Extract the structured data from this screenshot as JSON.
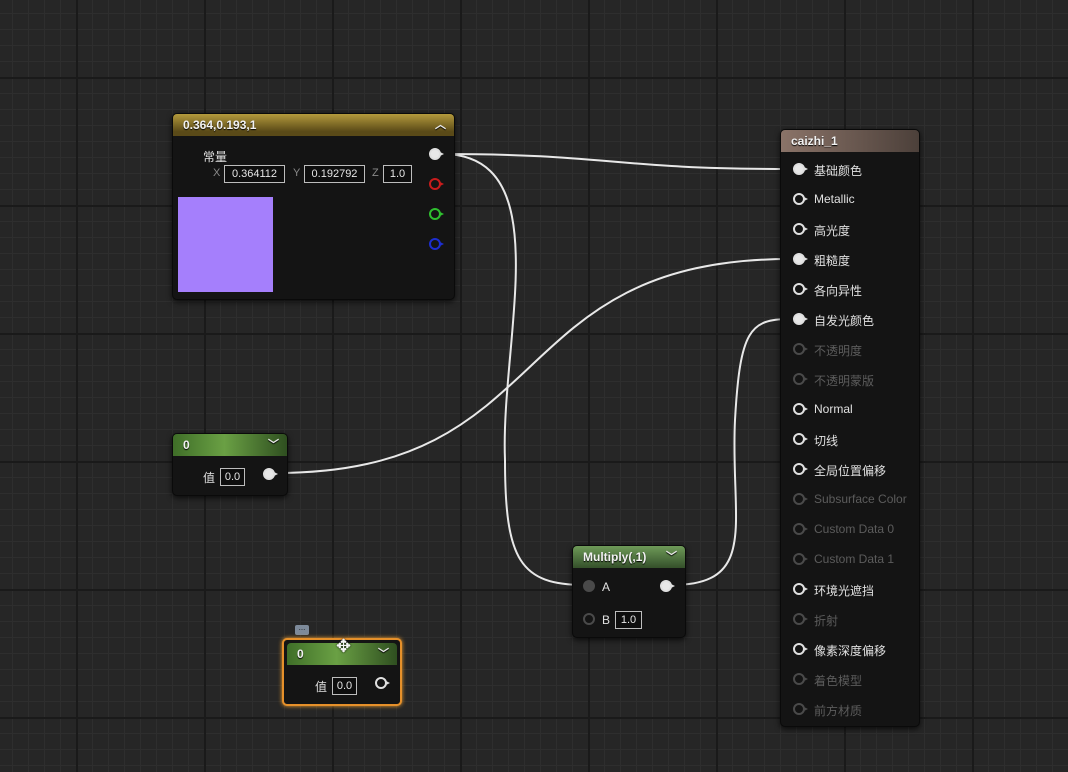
{
  "constant_node": {
    "title": "0.364,0.193,1",
    "output_label": "常量",
    "x_label": "X",
    "x_value": "0.364112",
    "y_label": "Y",
    "y_value": "0.192792",
    "z_label": "Z",
    "z_value": "1.0",
    "swatch_color": "#a57ffc"
  },
  "scalar_node_1": {
    "title": "0",
    "value_label": "值",
    "value": "0.0"
  },
  "scalar_node_2": {
    "title": "0",
    "value_label": "值",
    "value": "0.0"
  },
  "multiply_node": {
    "title": "Multiply(,1)",
    "input_a_label": "A",
    "input_b_label": "B",
    "input_b_value": "1.0"
  },
  "material_node": {
    "title": "caizhi_1",
    "inputs": [
      {
        "label": "基础颜色",
        "state": "connected"
      },
      {
        "label": "Metallic",
        "state": "active"
      },
      {
        "label": "高光度",
        "state": "active"
      },
      {
        "label": "粗糙度",
        "state": "connected"
      },
      {
        "label": "各向异性",
        "state": "active"
      },
      {
        "label": "自发光颜色",
        "state": "connected"
      },
      {
        "label": "不透明度",
        "state": "disabled"
      },
      {
        "label": "不透明蒙版",
        "state": "disabled"
      },
      {
        "label": "Normal",
        "state": "active"
      },
      {
        "label": "切线",
        "state": "active"
      },
      {
        "label": "全局位置偏移",
        "state": "active"
      },
      {
        "label": "Subsurface Color",
        "state": "disabled"
      },
      {
        "label": "Custom Data 0",
        "state": "disabled"
      },
      {
        "label": "Custom Data 1",
        "state": "disabled"
      },
      {
        "label": "环境光遮挡",
        "state": "active"
      },
      {
        "label": "折射",
        "state": "disabled"
      },
      {
        "label": "像素深度偏移",
        "state": "active"
      },
      {
        "label": "着色模型",
        "state": "disabled"
      },
      {
        "label": "前方材质",
        "state": "disabled"
      }
    ]
  },
  "colors": {
    "wire": "#e8e8e8",
    "selection": "#e6902a",
    "background": "#262626"
  }
}
